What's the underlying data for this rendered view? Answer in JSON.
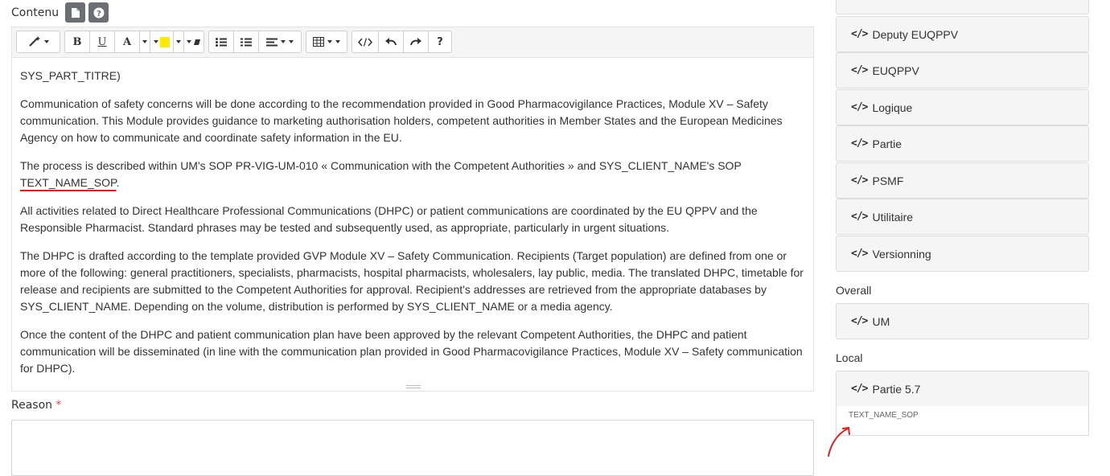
{
  "editor": {
    "label": "Contenu",
    "paragraphs": [
      "SYS_PART_TITRE)",
      "Communication of safety concerns will be done according to the recommendation provided in Good Pharmacovigilance Practices, Module XV – Safety communication. This Module provides guidance to marketing authorisation holders, competent authorities in Member States and the European Medicines Agency on how to communicate and coordinate safety information in the EU.",
      "All activities related to Direct Healthcare Professional Communications (DHPC) or patient communications are coordinated by the EU QPPV and the Responsible Pharmacist. Standard phrases may be tested and subsequently used, as appropriate, particularly in urgent situations.",
      "The DHPC is drafted according to the template provided GVP Module XV – Safety Communication. Recipients (Target population) are defined from one or more of the following: general practitioners, specialists, pharmacists, hospital pharmacists, wholesalers, lay public, media. The translated DHPC, timetable for release and recipients are submitted to the Competent Authorities for approval. Recipient's addresses are retrieved from the appropriate databases by SYS_CLIENT_NAME. Depending on the volume, distribution is performed by SYS_CLIENT_NAME or a media agency.",
      "Once the content of the DHPC and patient communication plan have been approved by the relevant Competent Authorities, the DHPC and patient communication will be disseminated (in line with the communication plan provided in Good Pharmacovigilance Practices, Module XV – Safety communication for DHPC)."
    ],
    "sop_text": "The process is described within UM's SOP PR-VIG-UM-010 « Communication with the Competent Authorities » and SYS_CLIENT_NAME's SOP ",
    "sop_token": "TEXT_NAME_SOP",
    "sop_end": "."
  },
  "toolbar": {
    "bold": "B",
    "underline": "U",
    "font_color": "A",
    "help": "?",
    "highlight_color": "#ffea00"
  },
  "reason": {
    "label": "Reason",
    "required_mark": "*"
  },
  "sidebar": {
    "code_symbol": "</>",
    "items": [
      "Deputy EUQPPV",
      "EUQPPV",
      "Logique",
      "Partie",
      "PSMF",
      "Utilitaire",
      "Versionning"
    ],
    "overall_label": "Overall",
    "overall_items": [
      "UM"
    ],
    "local_label": "Local",
    "local_items": [
      "Partie 5.7"
    ],
    "local_detail": "TEXT_NAME_SOP"
  },
  "colors": {
    "annotation_red": "#e0201a",
    "button_grey": "#6b6e72"
  }
}
